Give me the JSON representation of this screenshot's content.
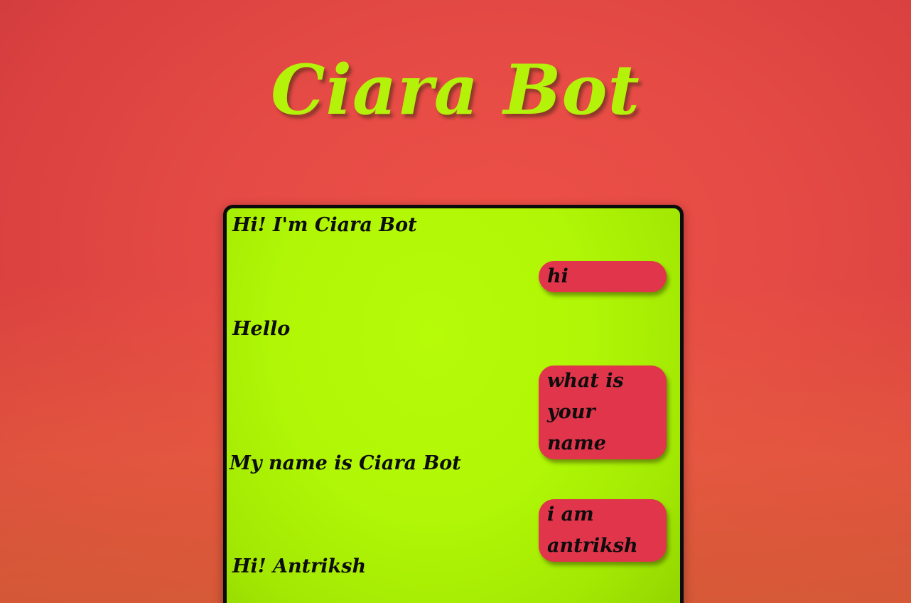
{
  "app": {
    "title": "Ciara Bot"
  },
  "chat": {
    "messages": [
      {
        "sender": "bot",
        "text": "Hi! I'm Ciara Bot"
      },
      {
        "sender": "user",
        "text": "hi"
      },
      {
        "sender": "bot",
        "text": "Hello"
      },
      {
        "sender": "user",
        "text": "what is your name"
      },
      {
        "sender": "bot",
        "text": "My name is Ciara Bot"
      },
      {
        "sender": "user",
        "text": "i am antriksh"
      },
      {
        "sender": "bot",
        "text": "Hi! Antriksh"
      }
    ]
  },
  "colors": {
    "background": "#e54a45",
    "title": "#b5f20a",
    "chat_window": "#b0f606",
    "user_bubble": "#e0354b",
    "text": "#0d0d0d"
  }
}
